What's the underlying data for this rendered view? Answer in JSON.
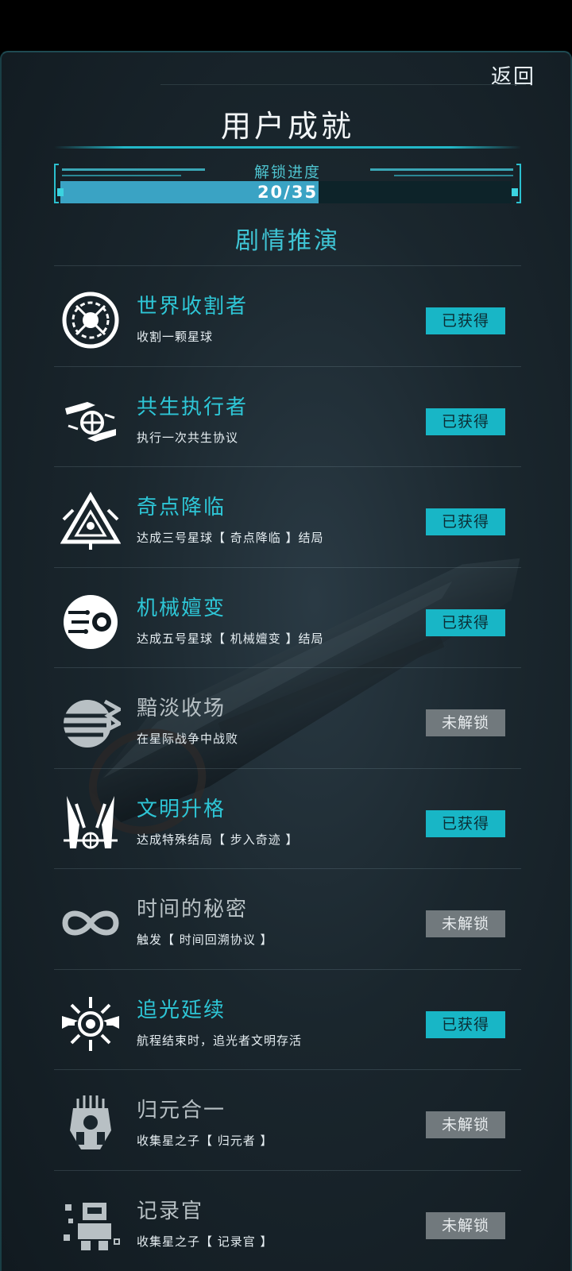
{
  "header": {
    "back_label": "返回",
    "title": "用户成就"
  },
  "progress": {
    "label": "解锁进度",
    "current": 20,
    "total": 35,
    "text": "20/35"
  },
  "section": {
    "title": "剧情推演"
  },
  "achievements": [
    {
      "name": "世界收割者",
      "desc": "收割一颗星球",
      "status": "已获得",
      "unlocked": true,
      "icon": "harvest-planet-icon"
    },
    {
      "name": "共生执行者",
      "desc": "执行一次共生协议",
      "status": "已获得",
      "unlocked": true,
      "icon": "symbiosis-hands-icon"
    },
    {
      "name": "奇点降临",
      "desc": "达成三号星球【 奇点降临 】结局",
      "status": "已获得",
      "unlocked": true,
      "icon": "singularity-triangle-icon"
    },
    {
      "name": "机械嬗变",
      "desc": "达成五号星球【 机械嬗变 】结局",
      "status": "已获得",
      "unlocked": true,
      "icon": "mechanical-eye-icon"
    },
    {
      "name": "黯淡收场",
      "desc": "在星际战争中战败",
      "status": "未解锁",
      "unlocked": false,
      "icon": "dim-planet-icon"
    },
    {
      "name": "文明升格",
      "desc": "达成特殊结局【 步入奇迹 】",
      "status": "已获得",
      "unlocked": true,
      "icon": "winged-emblem-icon"
    },
    {
      "name": "时间的秘密",
      "desc": "触发【 时间回溯协议 】",
      "status": "未解锁",
      "unlocked": false,
      "icon": "infinity-icon"
    },
    {
      "name": "追光延续",
      "desc": "航程结束时，追光者文明存活",
      "status": "已获得",
      "unlocked": true,
      "icon": "radiant-sun-icon"
    },
    {
      "name": "归元合一",
      "desc": "收集星之子【 归元者 】",
      "status": "未解锁",
      "unlocked": false,
      "icon": "robot-mask-icon"
    },
    {
      "name": "记录官",
      "desc": "收集星之子【 记录官 】",
      "status": "未解锁",
      "unlocked": false,
      "icon": "pixel-robot-icon"
    }
  ],
  "colors": {
    "accent": "#2ec6d6",
    "unlocked_badge": "#18b6c6",
    "locked_badge": "#71797d",
    "progress_fill": "#3aa3c4"
  }
}
